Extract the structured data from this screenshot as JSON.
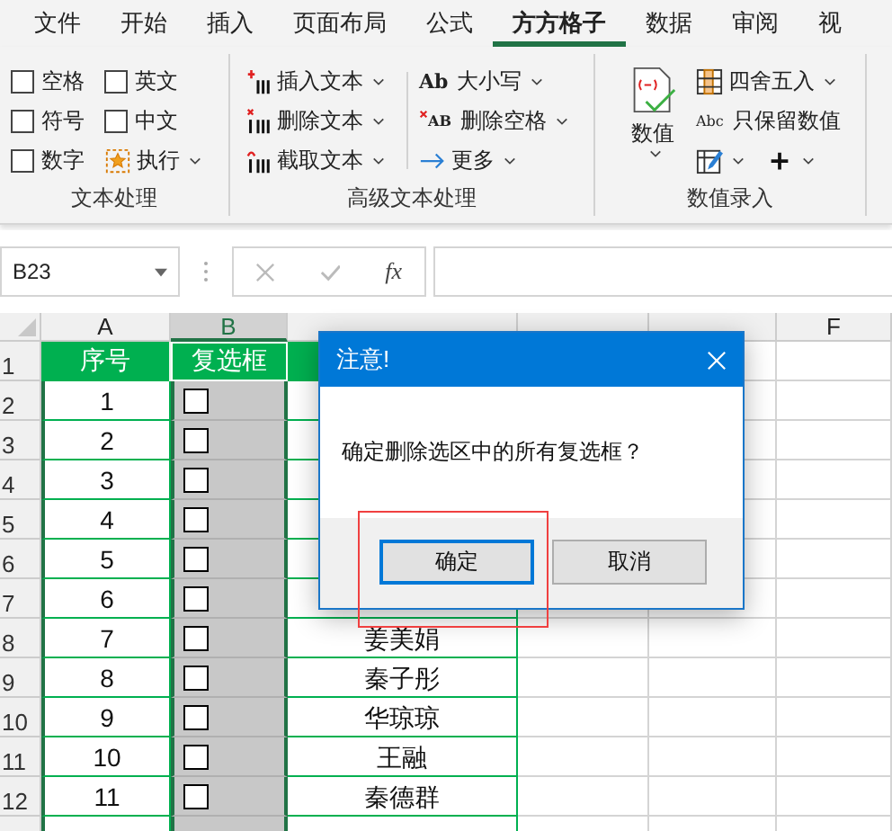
{
  "tabs": [
    {
      "label": "文件",
      "selected": false
    },
    {
      "label": "开始",
      "selected": false
    },
    {
      "label": "插入",
      "selected": false
    },
    {
      "label": "页面布局",
      "selected": false
    },
    {
      "label": "公式",
      "selected": false
    },
    {
      "label": "方方格子",
      "selected": true
    },
    {
      "label": "数据",
      "selected": false
    },
    {
      "label": "审阅",
      "selected": false
    },
    {
      "label": "视",
      "selected": false
    }
  ],
  "ribbon": {
    "groups": [
      {
        "label": "文本处理",
        "options": [
          {
            "label": "空格",
            "checked": false
          },
          {
            "label": "英文",
            "checked": false
          },
          {
            "label": "符号",
            "checked": false
          },
          {
            "label": "中文",
            "checked": false
          },
          {
            "label": "数字",
            "checked": false
          }
        ],
        "buttons": [
          {
            "label": "执行"
          }
        ]
      },
      {
        "label": "高级文本处理",
        "buttons": [
          {
            "label": "插入文本"
          },
          {
            "label": "删除文本"
          },
          {
            "label": "截取文本"
          },
          {
            "label": "大小写",
            "icon_text": "Ab"
          },
          {
            "label": "删除空格",
            "icon_text": "AB"
          },
          {
            "label": "更多"
          }
        ]
      },
      {
        "label": "数值录入",
        "buttons": [
          {
            "label": "数值"
          },
          {
            "label": "四舍五入"
          },
          {
            "label": "只保留数值",
            "icon_text": "Abc"
          }
        ]
      }
    ]
  },
  "formula_bar": {
    "name_box": "B23",
    "function_label": "fx"
  },
  "sheet": {
    "columns": [
      {
        "label": "A",
        "selected": false
      },
      {
        "label": "B",
        "selected": true
      },
      {
        "selected": false
      },
      {
        "selected": false
      },
      {
        "selected": false
      },
      {
        "label": "F",
        "selected": false
      }
    ],
    "header_row": {
      "row": "1",
      "cells": [
        "序号",
        "复选框"
      ]
    },
    "rows": [
      {
        "row": "2",
        "seq": "1",
        "checked": false
      },
      {
        "row": "3",
        "seq": "2",
        "checked": false
      },
      {
        "row": "4",
        "seq": "3",
        "checked": false
      },
      {
        "row": "5",
        "seq": "4",
        "checked": false
      },
      {
        "row": "6",
        "seq": "5",
        "checked": false
      },
      {
        "row": "7",
        "seq": "6",
        "checked": false
      },
      {
        "row": "8",
        "seq": "7",
        "checked": false,
        "name": "姜美娟"
      },
      {
        "row": "9",
        "seq": "8",
        "checked": false,
        "name": "秦子彤"
      },
      {
        "row": "10",
        "seq": "9",
        "checked": false,
        "name": "华琼琼"
      },
      {
        "row": "11",
        "seq": "10",
        "checked": false,
        "name": "王融"
      },
      {
        "row": "12",
        "seq": "11",
        "checked": false,
        "name": "秦德群"
      }
    ]
  },
  "dialog": {
    "title": "注意!",
    "message": "确定删除选区中的所有复选框？",
    "buttons": [
      {
        "label": "确定",
        "selected": true
      },
      {
        "label": "取消",
        "selected": false
      }
    ]
  }
}
